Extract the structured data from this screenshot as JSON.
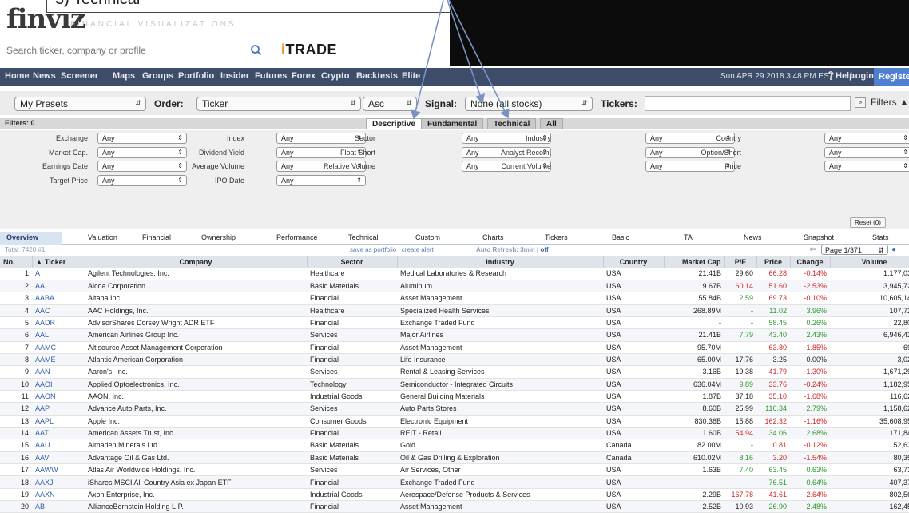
{
  "annotation": {
    "step": "3) Technical"
  },
  "header": {
    "logo": "finviz",
    "tagline": "FINANCIAL VISUALIZATIONS",
    "search_placeholder": "Search ticker, company or profile",
    "itrade_i": "i",
    "itrade_rest": "TRADE"
  },
  "nav": {
    "items": [
      "Home",
      "News",
      "Screener",
      "Maps",
      "Groups",
      "Portfolio",
      "Insider",
      "Futures",
      "Forex",
      "Crypto",
      "Backtests",
      "Elite"
    ],
    "datetime": "Sun APR 29 2018 3:48 PM EST",
    "help": "Help",
    "login": "Login",
    "register": "Register"
  },
  "controls": {
    "preset": "My Presets",
    "order_label": "Order:",
    "order": "Ticker",
    "direction": "Asc",
    "signal_label": "Signal:",
    "signal": "None (all stocks)",
    "tickers_label": "Tickers:",
    "filters": "Filters"
  },
  "filter_tabs": {
    "count": "Filters: 0",
    "tabs": [
      "Descriptive",
      "Fundamental",
      "Technical",
      "All"
    ]
  },
  "filter_grid": [
    [
      [
        "Exchange",
        "Any"
      ],
      [
        "Index",
        "Any"
      ],
      [
        "Sector",
        "Any"
      ],
      [
        "Industry",
        "Any"
      ],
      [
        "Country",
        "Any"
      ]
    ],
    [
      [
        "Market Cap.",
        "Any"
      ],
      [
        "Dividend Yield",
        "Any"
      ],
      [
        "Float Short",
        "Any"
      ],
      [
        "Analyst Recom.",
        "Any"
      ],
      [
        "Option/Short",
        "Any"
      ]
    ],
    [
      [
        "Earnings Date",
        "Any"
      ],
      [
        "Average Volume",
        "Any"
      ],
      [
        "Relative Volume",
        "Any"
      ],
      [
        "Current Volume",
        "Any"
      ],
      [
        "Price",
        "Any"
      ]
    ],
    [
      [
        "Target Price",
        "Any"
      ],
      [
        "IPO Date",
        "Any"
      ]
    ]
  ],
  "reset": "Reset (0)",
  "screen_tabs": [
    "Overview",
    "Valuation",
    "Financial",
    "Ownership",
    "Performance",
    "Technical",
    "Custom",
    "Charts",
    "Tickers",
    "Basic",
    "TA",
    "News",
    "Snapshot",
    "Stats"
  ],
  "total_row": {
    "total": "Total: 7420 #1",
    "save": "save as portfolio | create alert",
    "refresh": "Auto Refresh: 3min |",
    "refresh_off": "off",
    "page": "Page 1/371"
  },
  "table": {
    "headers": [
      "No.",
      "▲ Ticker",
      "Company",
      "Sector",
      "Industry",
      "Country",
      "Market Cap",
      "P/E",
      "Price",
      "Change",
      "Volume"
    ],
    "rows": [
      [
        "1",
        "A",
        "Agilent Technologies, Inc.",
        "Healthcare",
        "Medical Laboratories & Research",
        "USA",
        "21.41B",
        "29.60",
        "66.28",
        "-0.14%",
        "1,177,031"
      ],
      [
        "2",
        "AA",
        "Alcoa Corporation",
        "Basic Materials",
        "Aluminum",
        "USA",
        "9.67B",
        "60.14",
        "51.60",
        "-2.53%",
        "3,945,720"
      ],
      [
        "3",
        "AABA",
        "Altaba Inc.",
        "Financial",
        "Asset Management",
        "USA",
        "55.84B",
        "2.59",
        "69.73",
        "-0.10%",
        "10,605,148"
      ],
      [
        "4",
        "AAC",
        "AAC Holdings, Inc.",
        "Healthcare",
        "Specialized Health Services",
        "USA",
        "268.89M",
        "-",
        "11.02",
        "3.96%",
        "107,726"
      ],
      [
        "5",
        "AADR",
        "AdvisorShares Dorsey Wright ADR ETF",
        "Financial",
        "Exchange Traded Fund",
        "USA",
        "-",
        "-",
        "58.45",
        "0.26%",
        "22,807"
      ],
      [
        "6",
        "AAL",
        "American Airlines Group Inc.",
        "Services",
        "Major Airlines",
        "USA",
        "21.41B",
        "7.79",
        "43.40",
        "2.43%",
        "6,946,423"
      ],
      [
        "7",
        "AAMC",
        "Altisource Asset Management Corporation",
        "Financial",
        "Asset Management",
        "USA",
        "95.70M",
        "-",
        "63.80",
        "-1.85%",
        "693"
      ],
      [
        "8",
        "AAME",
        "Atlantic American Corporation",
        "Financial",
        "Life Insurance",
        "USA",
        "65.00M",
        "17.76",
        "3.25",
        "0.00%",
        "3,023"
      ],
      [
        "9",
        "AAN",
        "Aaron's, Inc.",
        "Services",
        "Rental & Leasing Services",
        "USA",
        "3.16B",
        "19.38",
        "41.79",
        "-1.30%",
        "1,671,293"
      ],
      [
        "10",
        "AAOI",
        "Applied Optoelectronics, Inc.",
        "Technology",
        "Semiconductor - Integrated Circuits",
        "USA",
        "636.04M",
        "9.89",
        "33.76",
        "-0.24%",
        "1,182,959"
      ],
      [
        "11",
        "AAON",
        "AAON, Inc.",
        "Industrial Goods",
        "General Building Materials",
        "USA",
        "1.87B",
        "37.18",
        "35.10",
        "-1.68%",
        "116,629"
      ],
      [
        "12",
        "AAP",
        "Advance Auto Parts, Inc.",
        "Services",
        "Auto Parts Stores",
        "USA",
        "8.60B",
        "25.99",
        "116.34",
        "2.79%",
        "1,158,628"
      ],
      [
        "13",
        "AAPL",
        "Apple Inc.",
        "Consumer Goods",
        "Electronic Equipment",
        "USA",
        "830.36B",
        "15.88",
        "162.32",
        "-1.16%",
        "35,608,959"
      ],
      [
        "14",
        "AAT",
        "American Assets Trust, Inc.",
        "Financial",
        "REIT - Retail",
        "USA",
        "1.60B",
        "54.94",
        "34.06",
        "2.68%",
        "171,847"
      ],
      [
        "15",
        "AAU",
        "Almaden Minerals Ltd.",
        "Basic Materials",
        "Gold",
        "Canada",
        "82.00M",
        "-",
        "0.81",
        "-0.12%",
        "52,633"
      ],
      [
        "16",
        "AAV",
        "Advantage Oil & Gas Ltd.",
        "Basic Materials",
        "Oil & Gas Drilling & Exploration",
        "Canada",
        "610.02M",
        "8.16",
        "3.20",
        "-1.54%",
        "80,350"
      ],
      [
        "17",
        "AAWW",
        "Atlas Air Worldwide Holdings, Inc.",
        "Services",
        "Air Services, Other",
        "USA",
        "1.63B",
        "7.40",
        "63.45",
        "0.63%",
        "63,736"
      ],
      [
        "18",
        "AAXJ",
        "iShares MSCI All Country Asia ex Japan ETF",
        "Financial",
        "Exchange Traded Fund",
        "USA",
        "-",
        "-",
        "76.51",
        "0.64%",
        "407,374"
      ],
      [
        "19",
        "AAXN",
        "Axon Enterprise, Inc.",
        "Industrial Goods",
        "Aerospace/Defense Products & Services",
        "USA",
        "2.29B",
        "167.78",
        "41.61",
        "-2.64%",
        "802,560"
      ],
      [
        "20",
        "AB",
        "AllianceBernstein Holding L.P.",
        "Financial",
        "Asset Management",
        "USA",
        "2.52B",
        "10.93",
        "26.90",
        "2.48%",
        "162,455"
      ]
    ]
  },
  "colors": {
    "nav_bg": "#3d4c68",
    "register_bg": "#4e7fd0",
    "negative": "#d42525",
    "positive": "#2a9a2a",
    "link": "#2f5ea8"
  }
}
